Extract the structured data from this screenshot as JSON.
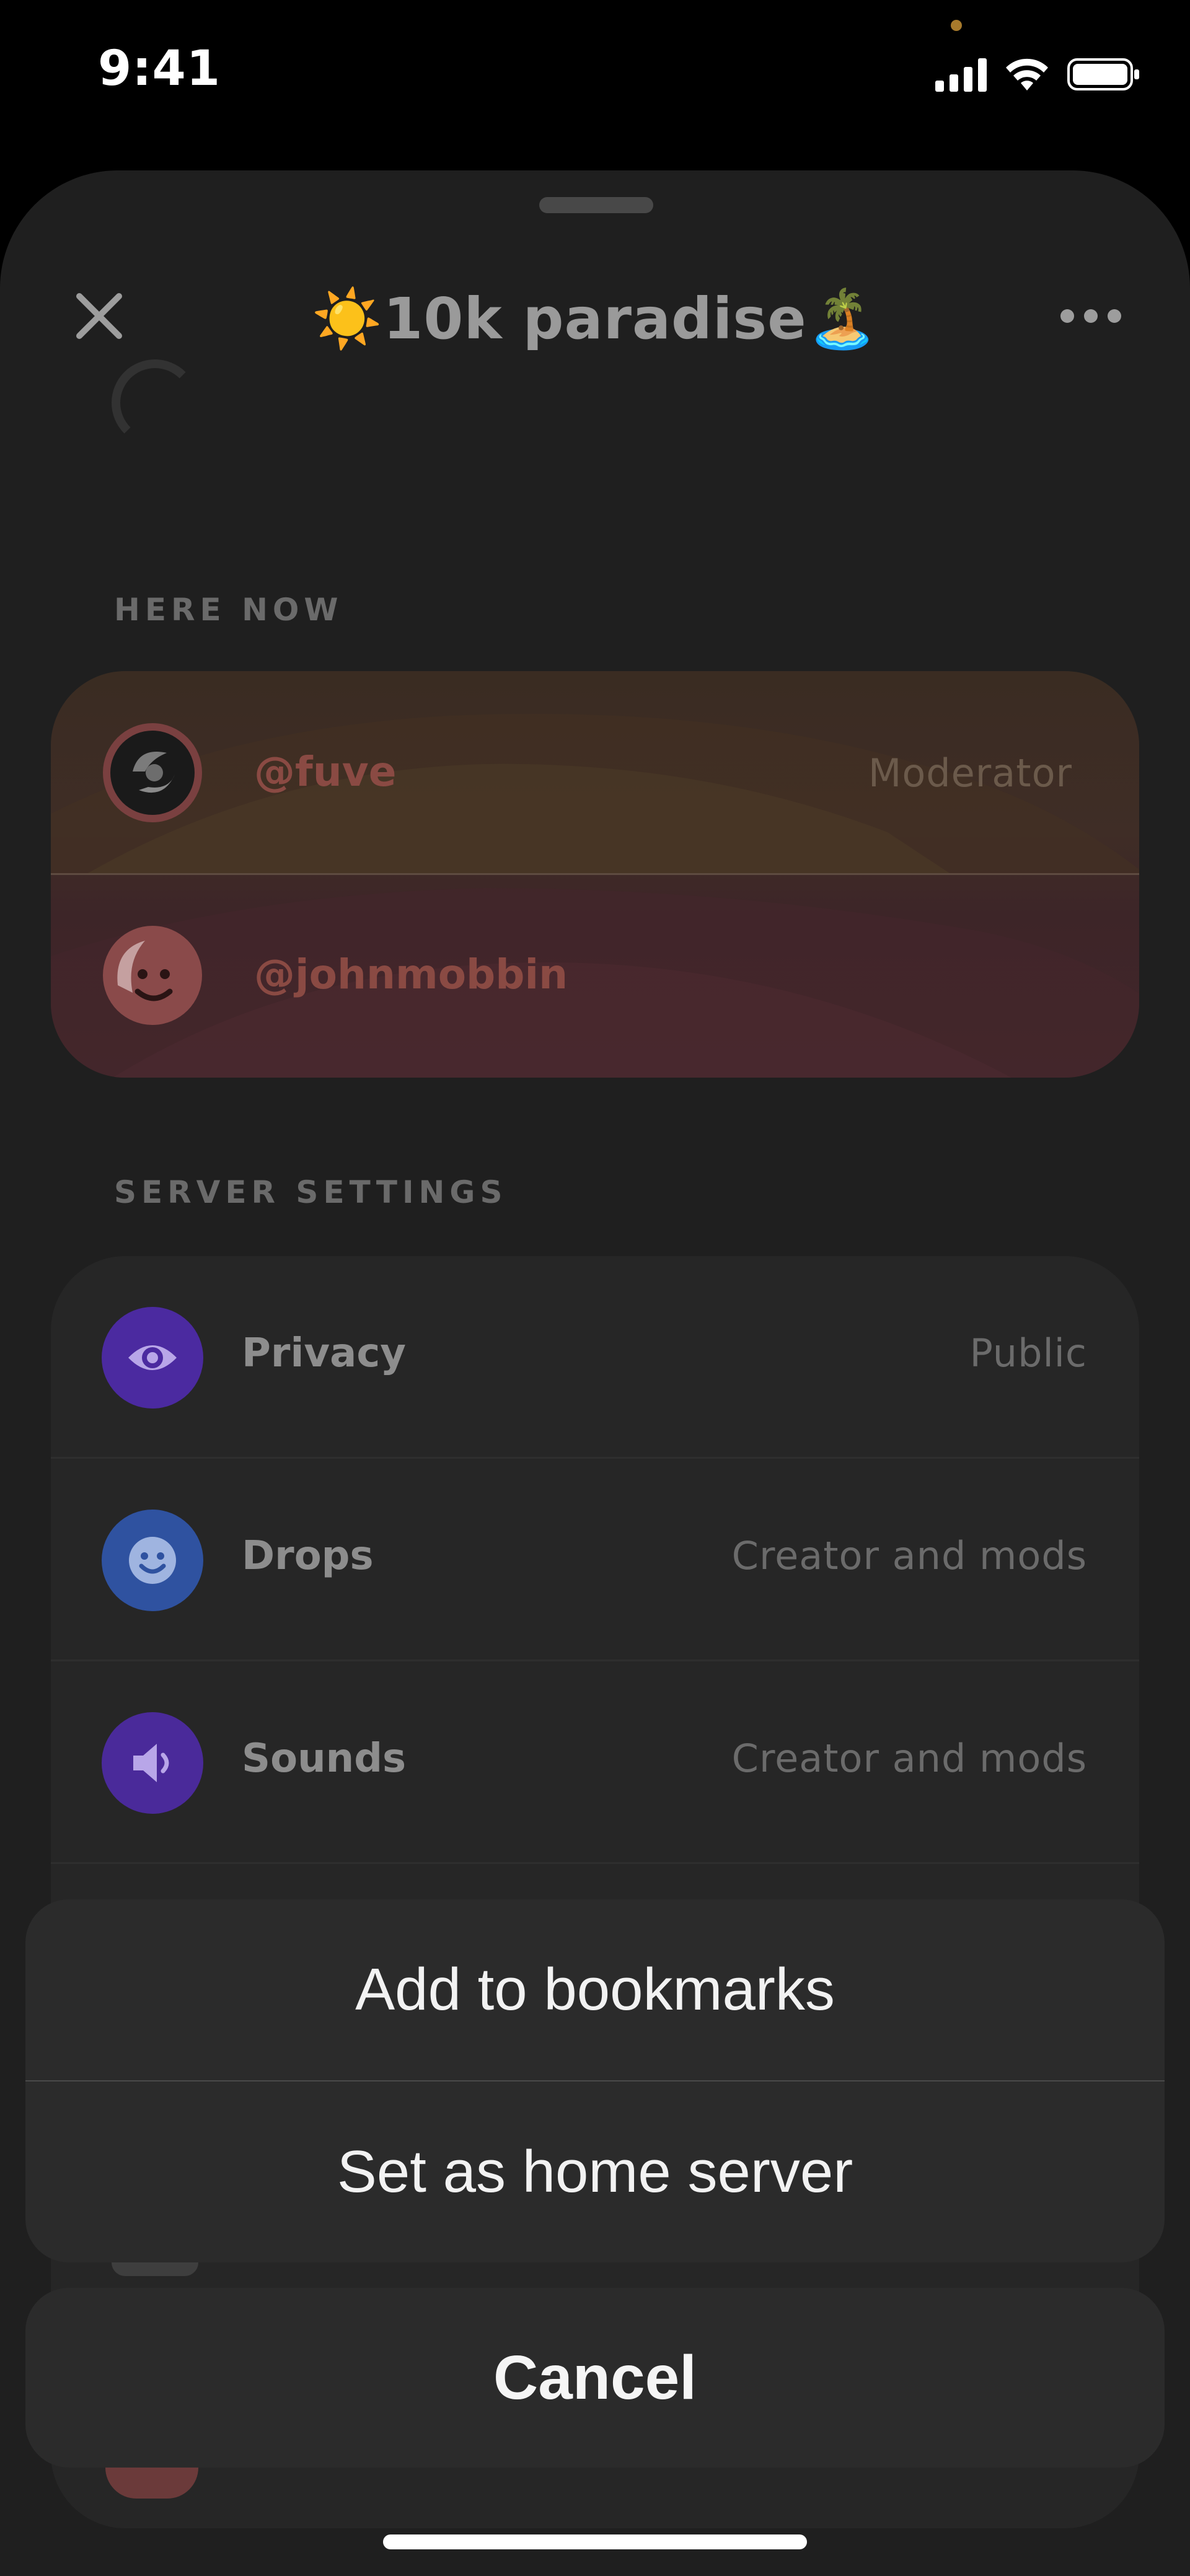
{
  "status_bar": {
    "time": "9:41"
  },
  "header": {
    "title": "☀️10k paradise🏝️",
    "close_icon": "close-icon",
    "more_icon": "more-icon"
  },
  "here_now": {
    "section_label": "HERE NOW",
    "members": [
      {
        "handle": "@fuve",
        "role": "Moderator"
      },
      {
        "handle": "@johnmobbin",
        "role": ""
      }
    ]
  },
  "server_settings": {
    "section_label": "SERVER SETTINGS",
    "items": [
      {
        "label": "Privacy",
        "value": "Public",
        "icon": "eye-icon",
        "color": "#4b2aa0"
      },
      {
        "label": "Drops",
        "value": "Creator and mods",
        "icon": "smiley-icon",
        "color": "#2f52a0"
      },
      {
        "label": "Sounds",
        "value": "Creator and mods",
        "icon": "speaker-icon",
        "color": "#4a2a9a"
      }
    ]
  },
  "action_sheet": {
    "actions": [
      {
        "label": "Add to bookmarks"
      },
      {
        "label": "Set as home server"
      }
    ],
    "cancel_label": "Cancel"
  }
}
